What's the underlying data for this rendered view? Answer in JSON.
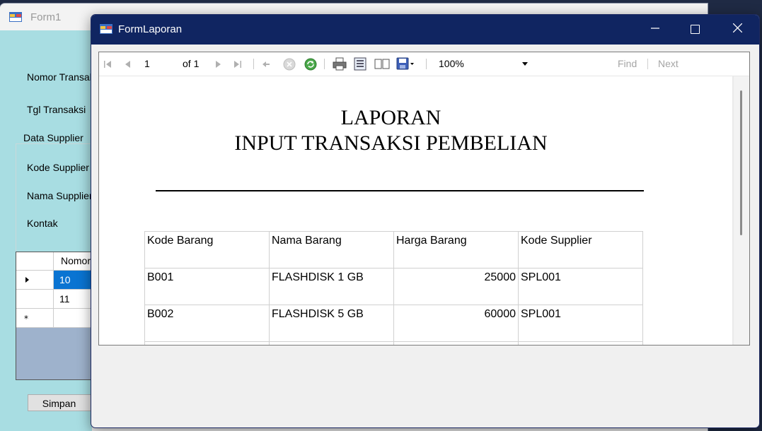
{
  "form1": {
    "title": "Form1",
    "labels": {
      "nomor_transaksi": "Nomor Transaksi",
      "tgl_transaksi": "Tgl Transaksi",
      "group_supplier": "Data Supplier",
      "kode_supplier": "Kode Supplier",
      "nama_supplier": "Nama Supplier",
      "kontak": "Kontak"
    },
    "grid": {
      "header": "Nomor",
      "rows": [
        "10",
        "11",
        ""
      ]
    },
    "simpan_label": "Simpan"
  },
  "form_laporan": {
    "title": "FormLaporan",
    "toolbar": {
      "page_current": "1",
      "page_of": "of 1",
      "zoom": "100%",
      "find": "Find",
      "next": "Next"
    },
    "report": {
      "title_line1": "LAPORAN",
      "title_line2": "INPUT TRANSAKSI PEMBELIAN",
      "columns": [
        "Kode Barang",
        "Nama Barang",
        "Harga Barang",
        "Kode Supplier"
      ],
      "rows": [
        [
          "B001",
          "FLASHDISK 1 GB",
          "25000",
          "SPL001"
        ],
        [
          "B002",
          "FLASHDISK 5 GB",
          "60000",
          "SPL001"
        ]
      ]
    }
  },
  "colors": {
    "titlebar": "#102561",
    "form1_panel": "#a8dde2",
    "grid_selection": "#0a74d2"
  }
}
